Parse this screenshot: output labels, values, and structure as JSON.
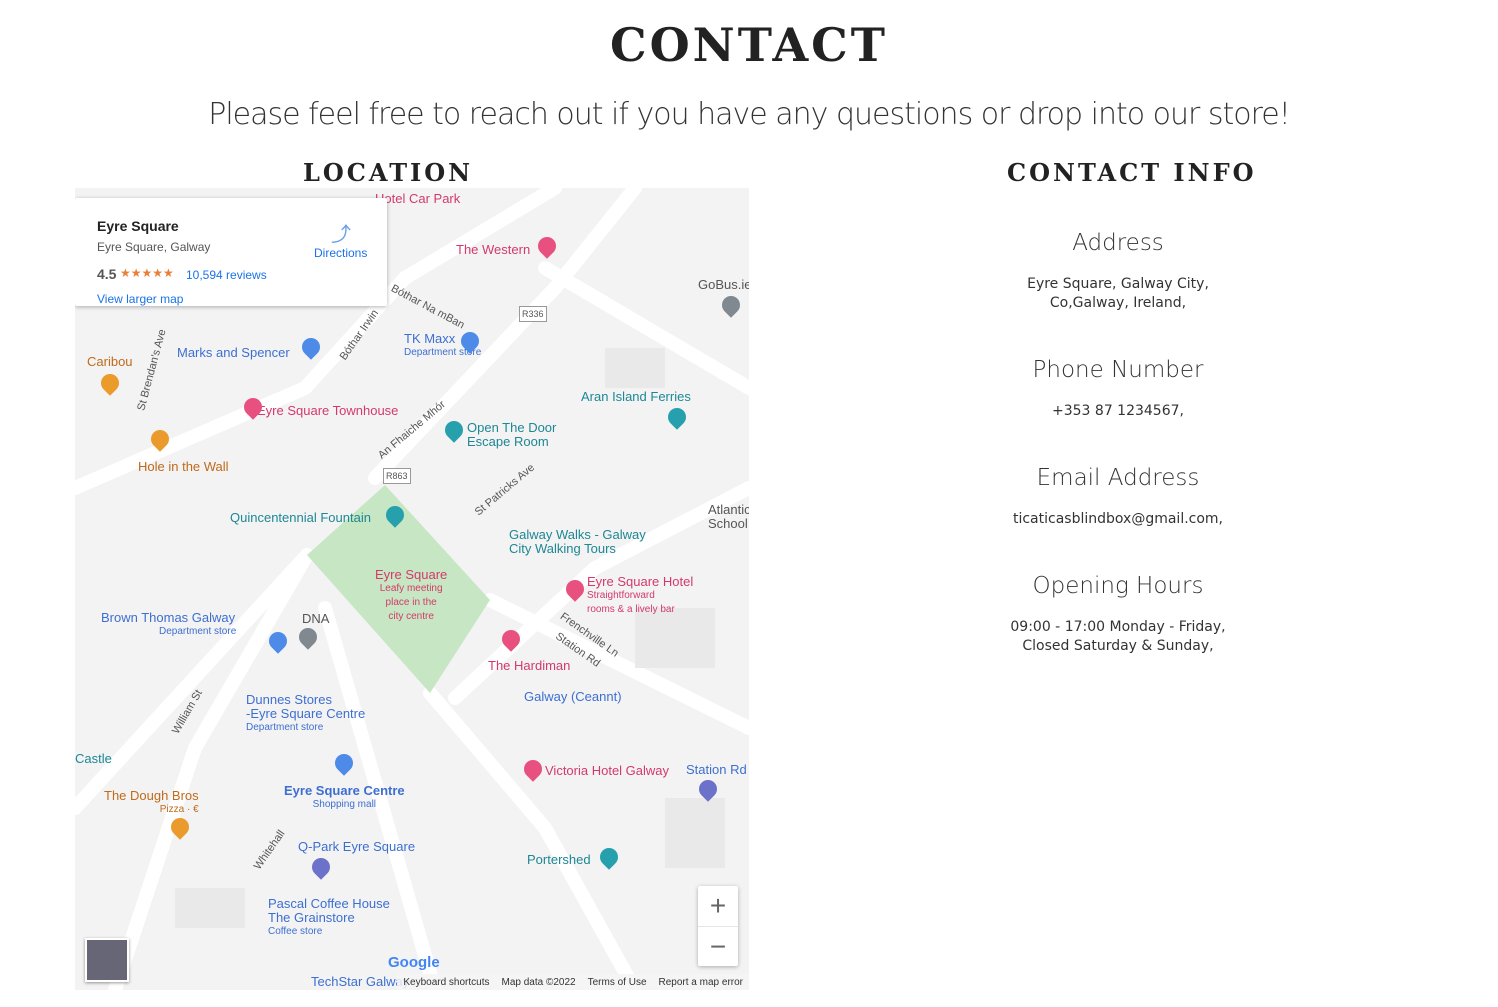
{
  "title": "CONTACT",
  "subtitle": "Please feel free to reach out if you have any questions or drop into our store!",
  "location": {
    "heading": "LOCATION",
    "card": {
      "name": "Eyre Square",
      "address": "Eyre Square, Galway",
      "rating": "4.5",
      "stars": "★★★★★",
      "reviews": "10,594 reviews",
      "view_larger": "View larger map",
      "directions": "Directions"
    },
    "labels": [
      "Marks and Spencer",
      "TK Maxx",
      "Department store",
      "The Western",
      "GoBus.ie",
      "Aran Island Ferries",
      "Eyre Square Townhouse",
      "Open The Door",
      "Escape Room",
      "Hole in the Wall",
      "Caribou",
      "Quincentennial Fountain",
      "Galway Walks - Galway",
      "City Walking Tours",
      "Eyre Square Hotel",
      "Straightforward",
      "rooms & a lively bar",
      "Eyre Square",
      "Leafy meeting",
      "place in the",
      "city centre",
      "Brown Thomas Galway",
      "Department store",
      "DNA",
      "The Hardiman",
      "Galway (Ceannt)",
      "Dunnes Stores",
      "-Eyre Square Centre",
      "Department store",
      "Victoria Hotel Galway",
      "Station Rd",
      "Eyre Square Centre",
      "Shopping mall",
      "The Dough Bros",
      "Pizza · €",
      "Q-Park Eyre Square",
      "Portershed",
      "Pascal Coffee House",
      "The Grainstore",
      "Coffee store",
      "TechStar Galway",
      "Castle",
      "R336",
      "R863",
      "Bóthar Na mBan",
      "St Patricks Ave",
      "An Fhaiche Mhór",
      "Frenchville Ln",
      "Station Rd",
      "William St",
      "Whitehall",
      "St Brendan's Ave",
      "Bóthar Irwin",
      "Atlantic School",
      "Hotel Car Park"
    ],
    "zoom_in": "+",
    "zoom_out": "−",
    "google": "Google",
    "attribution": [
      "Keyboard shortcuts",
      "Map data ©2022",
      "Terms of Use",
      "Report a map error"
    ]
  },
  "contact": {
    "heading": "CONTACT INFO",
    "items": [
      {
        "label": "Address",
        "lines": [
          "Eyre Square, Galway City,",
          "Co,Galway, Ireland,"
        ]
      },
      {
        "label": "Phone Number",
        "lines": [
          "+353 87 1234567,"
        ]
      },
      {
        "label": "Email Address",
        "lines": [
          "ticaticasblindbox@gmail.com,"
        ]
      },
      {
        "label": "Opening Hours",
        "lines": [
          "09:00 - 17:00 Monday - Friday,",
          "Closed Saturday & Sunday,"
        ]
      }
    ]
  }
}
